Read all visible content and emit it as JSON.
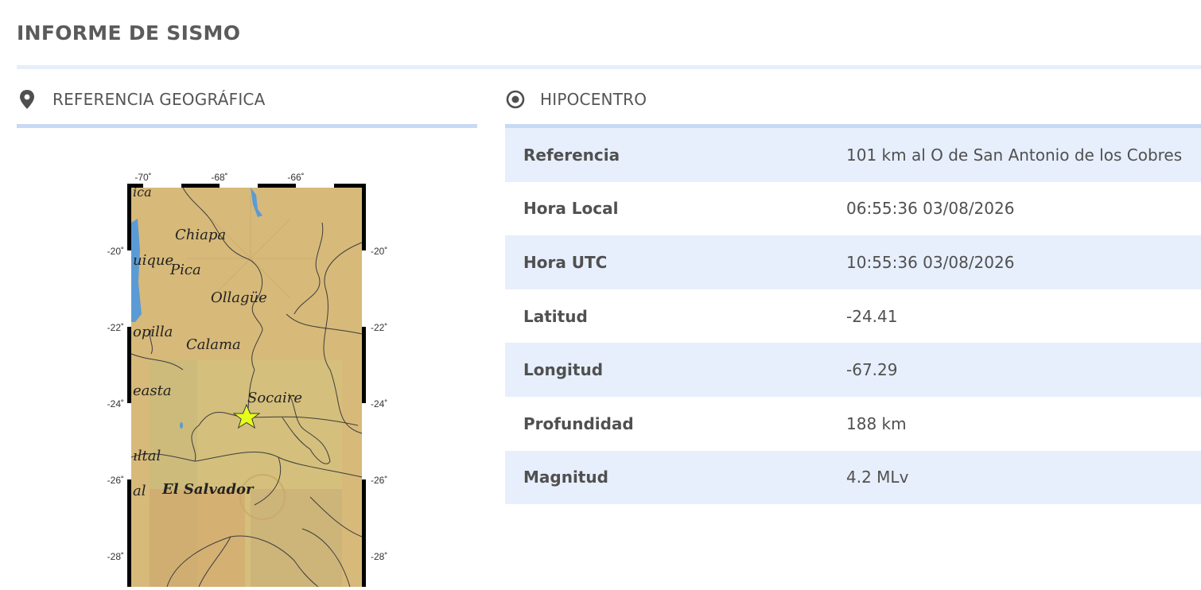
{
  "page": {
    "title": "INFORME DE SISMO"
  },
  "geo_section": {
    "heading": "REFERENCIA GEOGRÁFICA",
    "icon": "map-pin-icon",
    "map": {
      "top_ticks": [
        "-70˚",
        "-68˚",
        "-66˚"
      ],
      "left_ticks": [
        "-20˚",
        "-22˚",
        "-24˚",
        "-26˚",
        "-28˚"
      ],
      "right_ticks": [
        "-20˚",
        "-22˚",
        "-24˚",
        "-26˚",
        "-28˚"
      ],
      "places": [
        {
          "name": "ica"
        },
        {
          "name": "Chiapa"
        },
        {
          "name": "uique"
        },
        {
          "name": "Pica"
        },
        {
          "name": "Ollagüe"
        },
        {
          "name": "opilla"
        },
        {
          "name": "Calama"
        },
        {
          "name": "easta"
        },
        {
          "name": "Socaire"
        },
        {
          "name": "ıltal"
        },
        {
          "name": "al"
        },
        {
          "name": "El Salvador"
        }
      ],
      "epicenter_color": "#e6ff1a"
    }
  },
  "hipo_section": {
    "heading": "HIPOCENTRO",
    "icon": "target-icon",
    "rows": [
      {
        "label": "Referencia",
        "value": "101 km al O de San Antonio de los Cobres"
      },
      {
        "label": "Hora Local",
        "value": "06:55:36 03/08/2026"
      },
      {
        "label": "Hora UTC",
        "value": "10:55:36 03/08/2026"
      },
      {
        "label": "Latitud",
        "value": "-24.41"
      },
      {
        "label": "Longitud",
        "value": "-67.29"
      },
      {
        "label": "Profundidad",
        "value": "188 km"
      },
      {
        "label": "Magnitud",
        "value": "4.2 MLv"
      }
    ]
  },
  "colors": {
    "accent_rule": "#c7d9f4",
    "row_alt": "#e7effc",
    "map_land": "#d7b979"
  }
}
